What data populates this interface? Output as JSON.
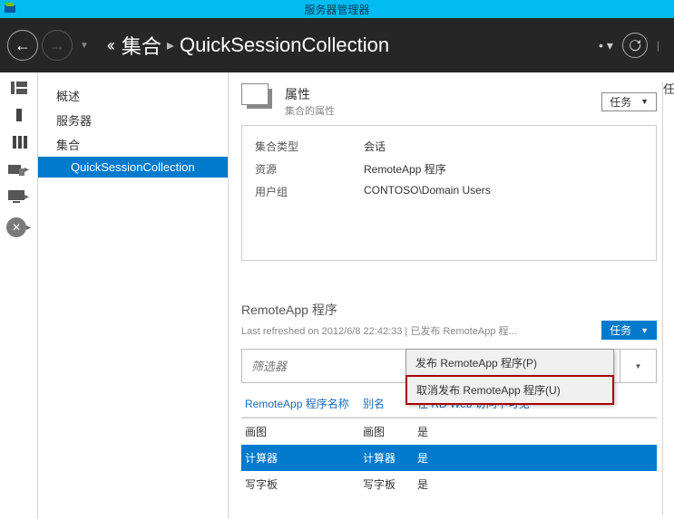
{
  "window": {
    "title": "服务器管理器"
  },
  "breadcrumb": {
    "parent_sep": "‹‹",
    "parent": "集合",
    "current": "QuickSessionCollection"
  },
  "tree": {
    "items": [
      "概述",
      "服务器",
      "集合"
    ],
    "sub": "QuickSessionCollection"
  },
  "properties_tile": {
    "title": "属性",
    "subtitle": "集合的属性",
    "tasks_label": "任务",
    "rows": [
      {
        "k": "集合类型",
        "v": "会话"
      },
      {
        "k": "资源",
        "v": "RemoteApp 程序"
      },
      {
        "k": "用户组",
        "v": "CONTOSO\\Domain Users"
      }
    ]
  },
  "remoteapp_tile": {
    "title": "RemoteApp 程序",
    "status": "Last refreshed on 2012/6/8 22:42:33 | 已发布 RemoteApp 程...",
    "tasks_label": "任务",
    "filter_placeholder": "筛选器",
    "menu": {
      "publish": "发布 RemoteApp 程序(P)",
      "unpublish": "取消发布 RemoteApp 程序(U)"
    },
    "columns": {
      "name": "RemoteApp 程序名称",
      "alias": "别名",
      "visible": "在 RD Web 访问中可见"
    },
    "rows": [
      {
        "name": "画图",
        "alias": "画图",
        "visible": "是",
        "selected": false
      },
      {
        "name": "计算器",
        "alias": "计算器",
        "visible": "是",
        "selected": true
      },
      {
        "name": "写字板",
        "alias": "写字板",
        "visible": "是",
        "selected": false
      }
    ]
  },
  "right_panel_hint": "任"
}
